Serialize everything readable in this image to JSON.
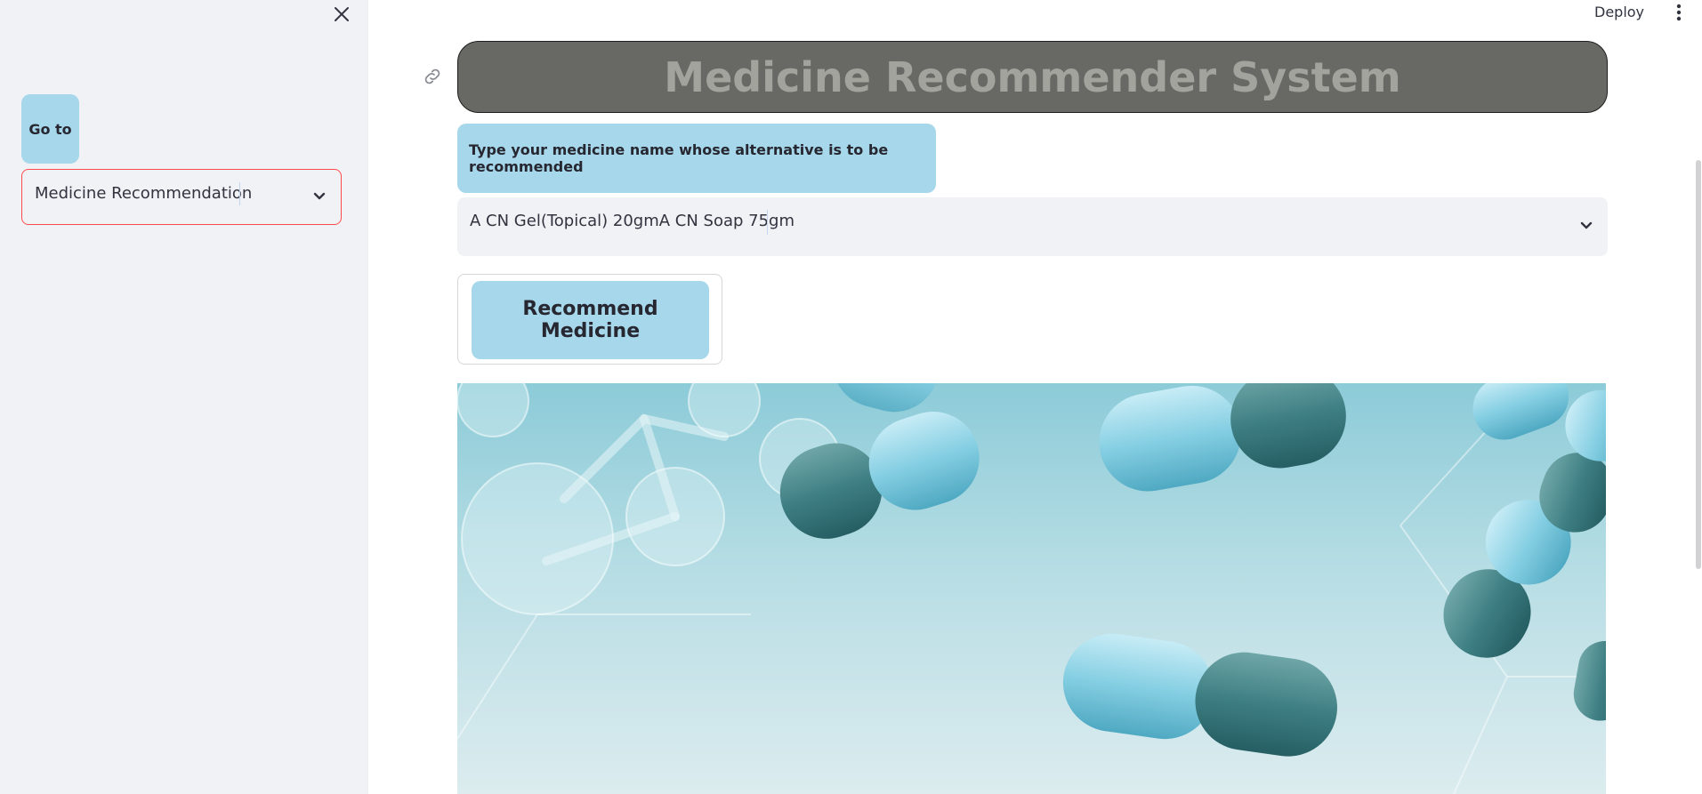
{
  "header": {
    "deploy_label": "Deploy"
  },
  "sidebar": {
    "goto_label": "Go to",
    "page_select": {
      "value": "Medicine Recommendation"
    }
  },
  "main": {
    "title": "Medicine Recommender System",
    "prompt_label": "Type your medicine name whose alternative is to be recommended",
    "medicine_select": {
      "value": "A CN Gel(Topical) 20gmA CN Soap 75gm"
    },
    "recommend_button_label": "Recommend Medicine"
  },
  "icons": {
    "close": "close-icon",
    "menu": "vertical-dots-icon",
    "anchor": "link-icon",
    "dropdown": "chevron-down-icon"
  },
  "colors": {
    "sidebar_bg": "#f0f2f6",
    "label_bg": "#a6d7ea",
    "title_bg": "#686964",
    "title_text": "#a3a39e",
    "focus_border": "#ff4b4b"
  }
}
